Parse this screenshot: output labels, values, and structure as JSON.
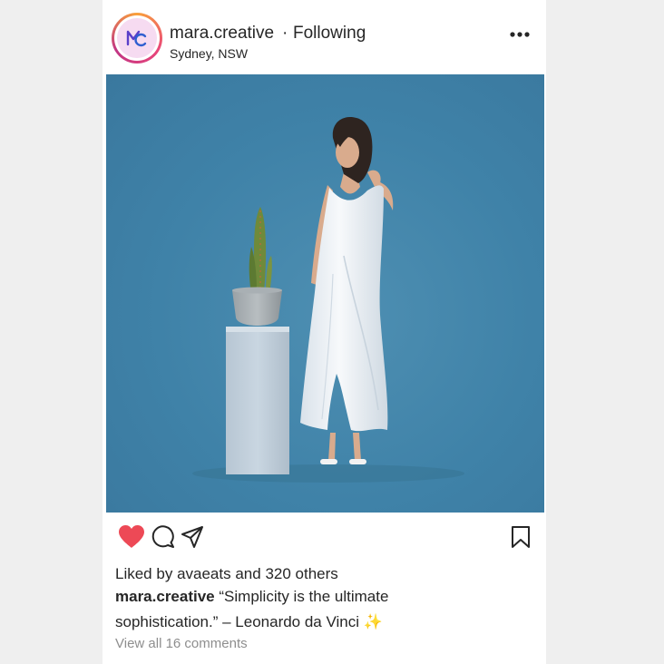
{
  "post": {
    "author": {
      "username": "mara.creative",
      "separator": "·",
      "follow_status": "Following",
      "location": "Sydney, NSW",
      "avatar_monogram": "MC"
    },
    "menu_icon": "more-horizontal-icon",
    "image": {
      "subject": "Woman in white ruffled wrap dress beside pedestal with potted cactus",
      "background_color": "#3f82a8"
    },
    "actions": {
      "like_icon": "heart-icon",
      "liked": true,
      "like_color": "#ed4956",
      "comment_icon": "comment-icon",
      "share_icon": "paper-plane-icon",
      "save_icon": "bookmark-icon"
    },
    "likes": {
      "prefix": "Liked by",
      "liked_by": "avaeats",
      "conjunction": "and",
      "others": "320 others"
    },
    "caption": {
      "username": "mara.creative",
      "text": "“Simplicity is the ultimate sophistication.” – Leonardo da Vinci",
      "emoji": "✨"
    },
    "comments_link": "View all 16 comments"
  }
}
